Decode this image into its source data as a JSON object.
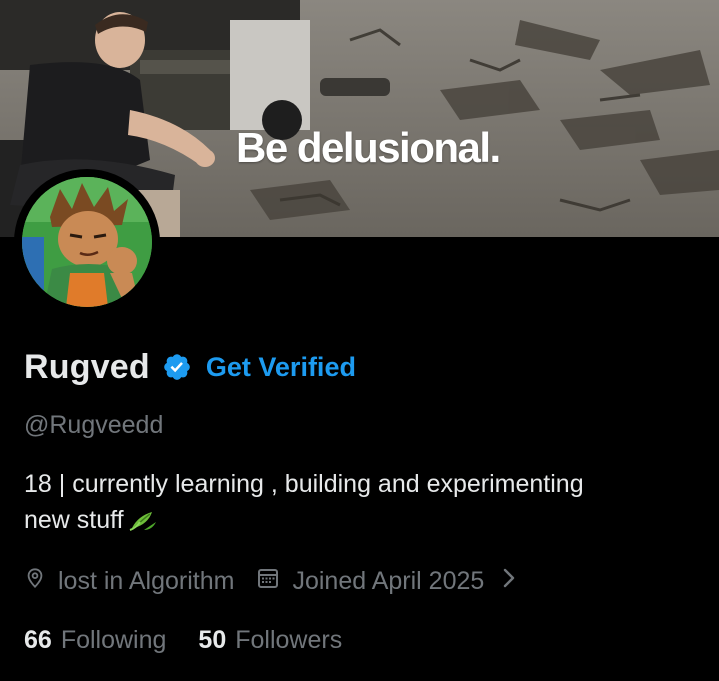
{
  "banner": {
    "caption": "Be delusional."
  },
  "profile": {
    "display_name": "Rugved",
    "verified_icon": "verified-check-icon",
    "get_verified_label": "Get Verified",
    "handle": "@Rugveedd",
    "bio_line_1": "18 | currently learning , building and experimenting",
    "bio_line_2": "new stuff",
    "bio_emoji": "leaf-icon",
    "location": "lost in Algorithm",
    "joined": "Joined April 2025"
  },
  "stats": {
    "following_count": "66",
    "following_label": "Following",
    "followers_count": "50",
    "followers_label": "Followers"
  },
  "colors": {
    "background": "#000000",
    "primary_text": "#e7e9ea",
    "secondary_text": "#71767b",
    "accent": "#1d9bf0"
  }
}
